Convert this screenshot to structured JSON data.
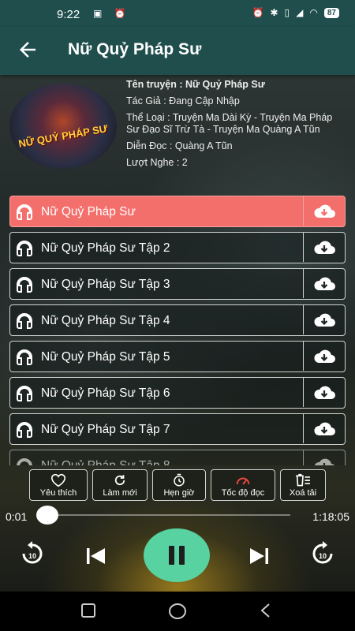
{
  "status_bar": {
    "time": "9:22",
    "battery": "87"
  },
  "header": {
    "title": "Nữ Quỷ Pháp Sư"
  },
  "cover": {
    "text": "NỮ QUỶ PHÁP SƯ"
  },
  "info": {
    "name": "Tên truyện : Nữ Quỷ Pháp Sư",
    "author": "Tác Giả :  Đang Cập Nhập",
    "genre": "Thể Loại : Truyện Ma Dài Kỳ - Truyện Ma Pháp Sư Đạo Sĩ Trừ Tà - Truyện Ma Quàng A Tũn",
    "narrator": "Diễn Đọc : Quàng A Tũn",
    "listens": "Lượt Nghe : 2"
  },
  "episodes": [
    {
      "label": "Nữ Quỷ Pháp Sư",
      "active": true
    },
    {
      "label": "Nữ Quỷ Pháp Sư Tập 2"
    },
    {
      "label": "Nữ Quỷ Pháp Sư Tập 3"
    },
    {
      "label": "Nữ Quỷ Pháp Sư Tập 4"
    },
    {
      "label": "Nữ Quỷ Pháp Sư Tập 5"
    },
    {
      "label": "Nữ Quỷ Pháp Sư Tập 6"
    },
    {
      "label": "Nữ Quỷ Pháp Sư Tập 7"
    },
    {
      "label": "Nữ Quỷ Pháp Sư Tập 8"
    }
  ],
  "actions": {
    "favorite": "Yêu thích",
    "refresh": "Làm mới",
    "timer": "Hẹn giờ",
    "speed": "Tốc độ đọc",
    "delete": "Xoá tải"
  },
  "player": {
    "current_time": "0:01",
    "duration": "1:18:05",
    "progress": 0.0002,
    "skip_seconds": "10"
  },
  "colors": {
    "header_bg": "#1f4e4c",
    "active_row": "#f36f6c",
    "play_button": "#57d2a0",
    "speed_icon": "#e8473f"
  }
}
